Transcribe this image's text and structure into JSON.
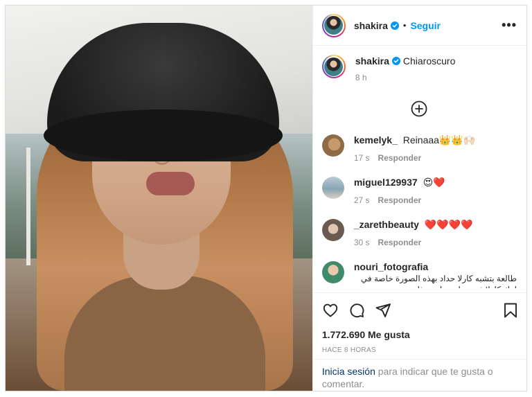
{
  "post": {
    "author": "shakira",
    "follow_label": "Seguir",
    "separator": "•",
    "more_label": "•••",
    "caption_text": "Chiaroscuro",
    "caption_time": "8 h"
  },
  "comments": [
    {
      "user": "kemelyk_",
      "text": "Reinaaa👑👑🙌🏻",
      "time": "17 s",
      "reply": "Responder"
    },
    {
      "user": "miguel129937",
      "text": "😍❤️",
      "time": "27 s",
      "reply": "Responder"
    },
    {
      "user": "_zarethbeauty",
      "text": "❤️❤️❤️❤️",
      "time": "30 s",
      "reply": "Responder"
    },
    {
      "user": "nouri_fotografia",
      "text": "طالعة بتشبه كارلا حداد بهذه الصورة خاصة في لوك كارلا في برنامج رامز هذا"
    }
  ],
  "actions": {
    "likes": "1.772.690 Me gusta",
    "timestamp": "HACE 8 HORAS"
  },
  "login": {
    "link": "Inicia sesión",
    "rest": "para indicar que te gusta o comentar."
  },
  "colors": {
    "accent": "#0095f6",
    "muted": "#8e8e8e",
    "text": "#262626",
    "link": "#00376b"
  },
  "icons": [
    "verified-badge-icon",
    "more-options-icon",
    "load-more-plus-icon",
    "heart-icon",
    "comment-icon",
    "share-icon",
    "bookmark-icon"
  ]
}
